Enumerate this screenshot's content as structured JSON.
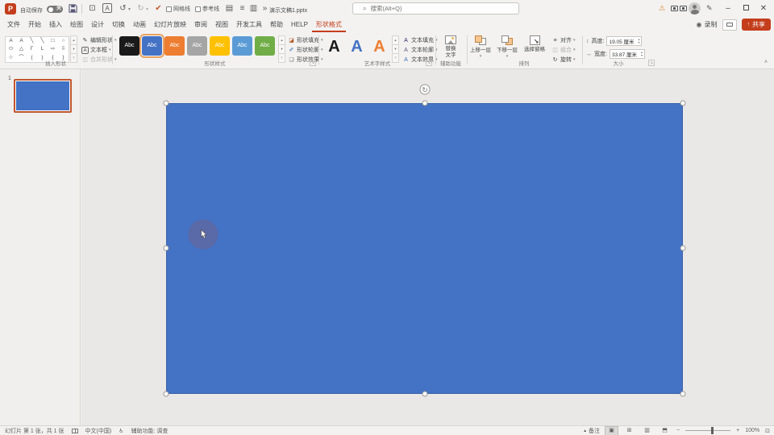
{
  "titlebar": {
    "logo_letter": "P",
    "autosave_label": "自动保存",
    "autosave_state": "关",
    "qat_checkbox1": "网格线",
    "qat_checkbox2": "参考线",
    "doc_title": "演示文稿1.pptx",
    "search_placeholder": "搜索(Alt+Q)"
  },
  "menubar": {
    "tabs": [
      "文件",
      "开始",
      "插入",
      "绘图",
      "设计",
      "切换",
      "动画",
      "幻灯片放映",
      "审阅",
      "视图",
      "开发工具",
      "帮助",
      "HELP",
      "形状格式"
    ],
    "record_label": "录制",
    "share_label": "共享"
  },
  "ribbon": {
    "insert_shapes": {
      "label": "插入形状",
      "edit_shape": "编辑形状",
      "text_box": "文本框",
      "merge_shapes": "合并形状",
      "gallery": [
        "A",
        "A",
        "╲",
        "╲",
        "□",
        "○",
        "⬭",
        "△",
        "Γ",
        "L",
        "⇨",
        "⇩",
        "☆",
        "⌒",
        "(",
        ")",
        "{",
        "}"
      ]
    },
    "shape_styles": {
      "label": "形状样式",
      "swatch_label": "Abc",
      "swatch_colors": [
        "#1a1a1a",
        "#4472c4",
        "#ed7d31",
        "#a5a5a5",
        "#ffc000",
        "#5b9bd5",
        "#70ad47"
      ],
      "fill": "形状填充",
      "outline": "形状轮廓",
      "effects": "形状效果"
    },
    "wordart": {
      "label": "艺术字样式",
      "letter": "A",
      "text_fill": "文本填充",
      "text_outline": "文本轮廓",
      "text_effects": "文本效果"
    },
    "accessibility": {
      "label": "辅助功能",
      "alt_text_line1": "替换",
      "alt_text_line2": "文字"
    },
    "arrange": {
      "label": "排列",
      "bring_forward": "上移一层",
      "send_backward": "下移一层",
      "selection_pane": "选择窗格",
      "align": "对齐",
      "group": "组合",
      "rotate": "旋转"
    },
    "size": {
      "label": "大小",
      "height_label": "高度:",
      "height_value": "19.05 厘米",
      "width_label": "宽度:",
      "width_value": "33.87 厘米"
    }
  },
  "slide_panel": {
    "slide_number": "1"
  },
  "canvas": {
    "shape_fill": "#4472c4"
  },
  "statusbar": {
    "slide_info": "幻灯片 第 1 张，共 1 张",
    "language": "中文(中国)",
    "accessibility": "辅助功能: 调查",
    "notes": "备注",
    "zoom_minus": "−",
    "zoom_plus": "+",
    "zoom_level": "100%"
  },
  "icons": {
    "caret": "▾",
    "scroll_up": "▴",
    "scroll_down": "▾",
    "scroll_more": "▿",
    "undo": "↺",
    "redo": "↻",
    "check": "✔",
    "overflow": "»",
    "warning": "⚠",
    "pen": "✎",
    "search": "⌕",
    "monitor": "⊡",
    "slide_pen": "▤",
    "align_lines": "≡",
    "columns": "▥",
    "record": "◉",
    "share_arrow": "↑",
    "minimize": "–",
    "close": "✕",
    "edit_shape": "✎",
    "merge": "◫",
    "fill": "◪",
    "outline_pen": "✐",
    "effects": "❏",
    "height": "↕",
    "width": "↔",
    "rotate_handle": "↻",
    "accessibility_person": "♿",
    "launcher": "↘",
    "collapse": "˄",
    "view_normal": "▣",
    "view_sorter": "⊞",
    "view_reading": "▥",
    "view_slideshow": "⬒",
    "fit_window": "⊡",
    "notes_tri": "▲"
  }
}
